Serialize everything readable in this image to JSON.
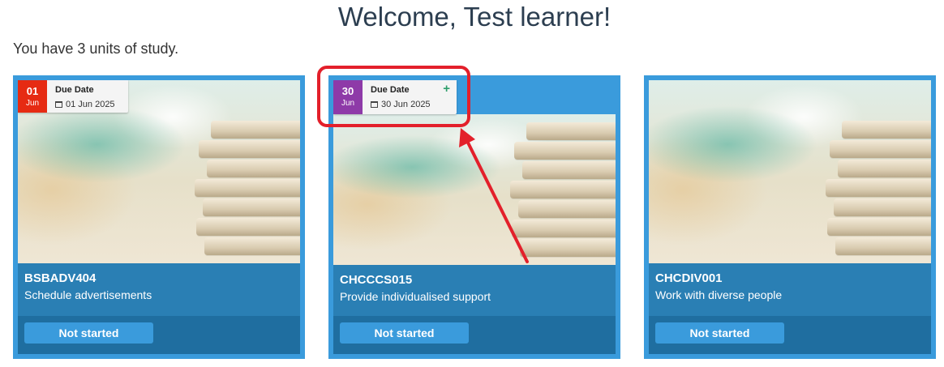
{
  "header": {
    "welcome": "Welcome, Test learner!",
    "units_text": "You have 3 units of study."
  },
  "cards": [
    {
      "due_day": "01",
      "due_month": "Jun",
      "due_title": "Due Date",
      "due_date": "01 Jun 2025",
      "date_color": "#e62b13",
      "code": "BSBADV404",
      "name": "Schedule advertisements",
      "status": "Not started"
    },
    {
      "due_day": "30",
      "due_month": "Jun",
      "due_title": "Due Date",
      "due_date": "30 Jun 2025",
      "date_color": "#8e3aa8",
      "plus_icon": "+",
      "code": "CHCCCS015",
      "name": "Provide individualised support",
      "status": "Not started"
    },
    {
      "code": "CHCDIV001",
      "name": "Work with diverse people",
      "status": "Not started"
    }
  ],
  "colors": {
    "card_border": "#3a9bdc",
    "panel": "#2a7fb4",
    "annotation": "#e3202b"
  }
}
